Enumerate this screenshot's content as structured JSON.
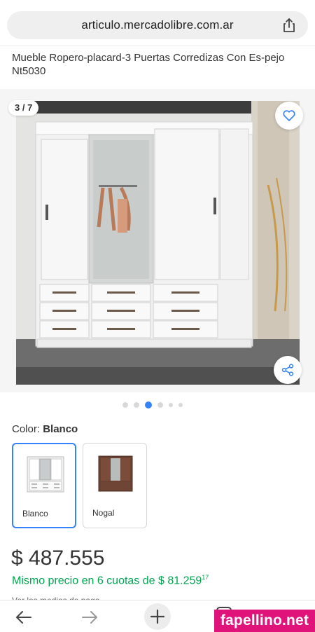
{
  "browser": {
    "url": "articulo.mercadolibre.com.ar",
    "icons": {
      "share": "share-icon",
      "back": "arrow-left-icon",
      "forward": "arrow-right-icon",
      "new_tab": "plus-icon",
      "tabs": "tabs-icon"
    }
  },
  "product": {
    "title": "Mueble Ropero-placard-3 Puertas Corredizas Con Es-pejo Nt5030"
  },
  "gallery": {
    "counter": "3 / 7",
    "dot_count": 6,
    "active_dot": 3,
    "icons": {
      "favorite": "heart-icon",
      "share": "share-nodes-icon"
    }
  },
  "color": {
    "label": "Color: ",
    "selected": "Blanco",
    "options": [
      {
        "name": "Blanco"
      },
      {
        "name": "Nogal"
      }
    ]
  },
  "pricing": {
    "price": "$ 487.555",
    "installments_text": "Mismo precio en 6 cuotas de $ 81.259",
    "installments_cents": "17",
    "payment_link": "Ver los medios de pago"
  },
  "watermark": "fapellino.net",
  "colors": {
    "accent_blue": "#3483fa",
    "green": "#00a650",
    "watermark": "#e0137a"
  }
}
